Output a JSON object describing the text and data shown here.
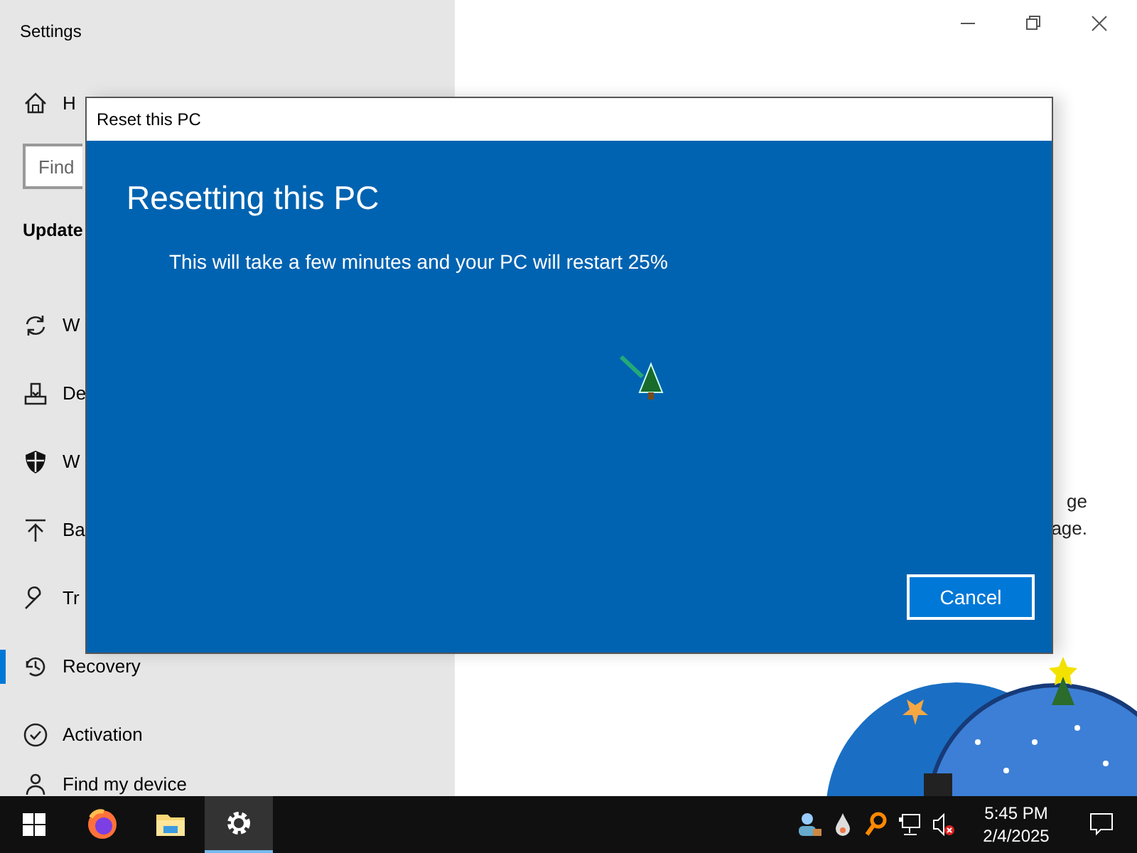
{
  "settings": {
    "title": "Settings",
    "nav": [
      {
        "kind": "item",
        "label": "H",
        "selected": false
      },
      {
        "kind": "search",
        "placeholder": "Find"
      },
      {
        "kind": "heading",
        "label": "Update"
      },
      {
        "kind": "item",
        "label": "W",
        "selected": false
      },
      {
        "kind": "item",
        "label": "De",
        "selected": false
      },
      {
        "kind": "item",
        "label": "W",
        "selected": false
      },
      {
        "kind": "item",
        "label": "Ba",
        "selected": false
      },
      {
        "kind": "item",
        "label": "Tr",
        "selected": false
      },
      {
        "kind": "item",
        "label": "Recovery",
        "selected": true
      },
      {
        "kind": "item",
        "label": "Activation",
        "selected": false
      },
      {
        "kind": "item",
        "label": "Find my device",
        "selected": false
      }
    ],
    "content_lines": [
      "ge",
      "age."
    ]
  },
  "dialog": {
    "title": "Reset this PC",
    "heading": "Resetting this PC",
    "message": "This will take a few minutes and your PC will restart 25%",
    "buttons": [
      "Cancel"
    ]
  },
  "taskbar": {
    "apps": [
      {
        "selected": false
      },
      {
        "selected": false
      },
      {
        "selected": true
      }
    ],
    "time": "5:45 PM",
    "date": "2/4/2025"
  }
}
